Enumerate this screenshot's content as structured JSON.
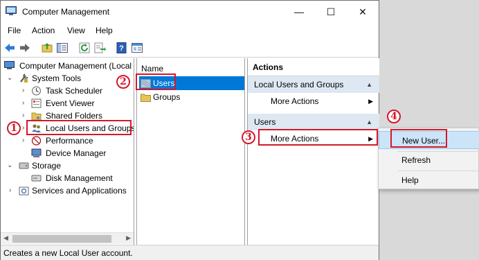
{
  "window": {
    "title": "Computer Management",
    "controls": {
      "minimize": "—",
      "maximize": "☐",
      "close": "✕"
    }
  },
  "menu": [
    "File",
    "Action",
    "View",
    "Help"
  ],
  "toolbar": [
    "back-icon",
    "forward-icon",
    "up-folder-icon",
    "show-hide-tree-icon",
    "refresh-icon",
    "export-list-icon",
    "help-icon",
    "properties-icon"
  ],
  "tree": {
    "root": "Computer Management (Local",
    "items": [
      {
        "label": "System Tools"
      },
      {
        "label": "Task Scheduler"
      },
      {
        "label": "Event Viewer"
      },
      {
        "label": "Shared Folders"
      },
      {
        "label": "Local Users and Groups"
      },
      {
        "label": "Performance"
      },
      {
        "label": "Device Manager"
      },
      {
        "label": "Storage"
      },
      {
        "label": "Disk Management"
      },
      {
        "label": "Services and Applications"
      }
    ]
  },
  "list": {
    "header": "Name",
    "items": [
      "Users",
      "Groups"
    ]
  },
  "actions": {
    "title": "Actions",
    "section1": "Local Users and Groups",
    "more_actions_1": "More Actions",
    "section2": "Users",
    "more_actions_2": "More Actions"
  },
  "context_menu": {
    "items": [
      "New User...",
      "Refresh",
      "Help"
    ]
  },
  "status": "Creates a new Local User account.",
  "annotations": [
    "1",
    "2",
    "3",
    "4"
  ],
  "colors": {
    "annotation_red": "#d4182a",
    "selection_blue": "#0078d7",
    "section_bg": "#dde8f3",
    "menu_highlight": "#cce4f7"
  }
}
